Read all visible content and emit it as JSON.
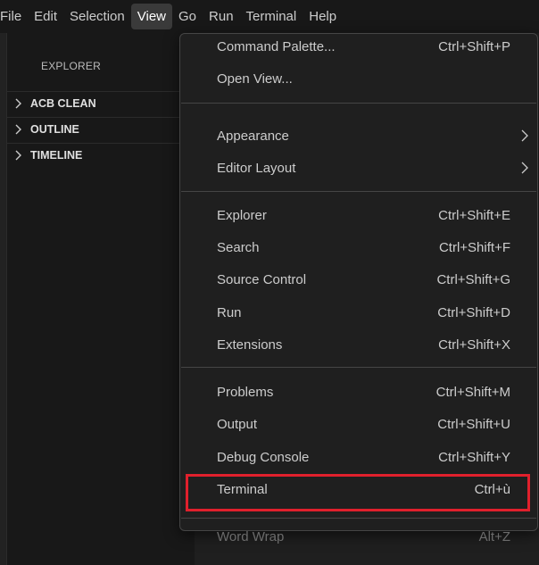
{
  "menubar": {
    "items": [
      {
        "label": "File"
      },
      {
        "label": "Edit"
      },
      {
        "label": "Selection"
      },
      {
        "label": "View"
      },
      {
        "label": "Go"
      },
      {
        "label": "Run"
      },
      {
        "label": "Terminal"
      },
      {
        "label": "Help"
      }
    ],
    "active": "View"
  },
  "sidebar": {
    "title": "EXPLORER",
    "sections": [
      {
        "label": "ACB CLEAN",
        "icon": "chevron-right-icon"
      },
      {
        "label": "OUTLINE",
        "icon": "chevron-right-icon"
      },
      {
        "label": "TIMELINE",
        "icon": "chevron-right-icon"
      }
    ]
  },
  "view_menu": {
    "items": [
      {
        "label": "Command Palette...",
        "shortcut": "Ctrl+Shift+P"
      },
      {
        "label": "Open View...",
        "shortcut": ""
      },
      {
        "label": "Appearance",
        "submenu": true
      },
      {
        "label": "Editor Layout",
        "submenu": true
      },
      {
        "label": "Explorer",
        "shortcut": "Ctrl+Shift+E"
      },
      {
        "label": "Search",
        "shortcut": "Ctrl+Shift+F"
      },
      {
        "label": "Source Control",
        "shortcut": "Ctrl+Shift+G"
      },
      {
        "label": "Run",
        "shortcut": "Ctrl+Shift+D"
      },
      {
        "label": "Extensions",
        "shortcut": "Ctrl+Shift+X"
      },
      {
        "label": "Problems",
        "shortcut": "Ctrl+Shift+M"
      },
      {
        "label": "Output",
        "shortcut": "Ctrl+Shift+U"
      },
      {
        "label": "Debug Console",
        "shortcut": "Ctrl+Shift+Y"
      },
      {
        "label": "Terminal",
        "shortcut": "Ctrl+ù"
      },
      {
        "label": "Word Wrap",
        "shortcut": "Alt+Z",
        "disabled": true
      }
    ],
    "highlighted": "Terminal",
    "highlight_color": "#e0202c"
  },
  "colors": {
    "background": "#181818",
    "menu_background": "#1f1f1f",
    "text": "#cccccc",
    "disabled_text": "#6b6b6b"
  }
}
